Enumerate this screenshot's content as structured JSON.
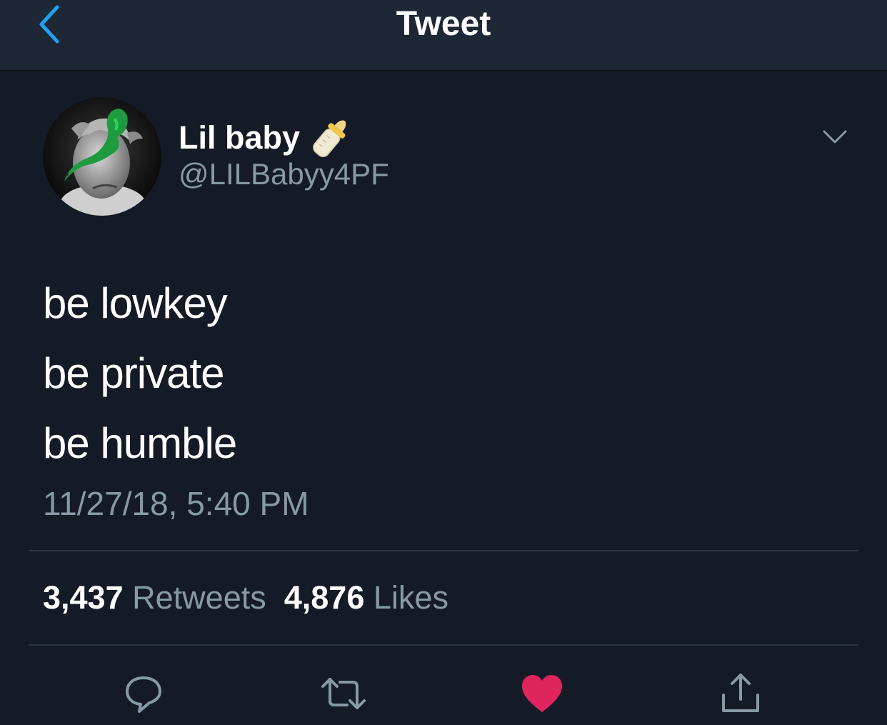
{
  "navbar": {
    "title": "Tweet",
    "back_icon": "chevron-left-icon"
  },
  "author": {
    "display_name": "Lil baby",
    "name_emoji": "baby-bottle-icon",
    "handle": "@LILBabyy4PF",
    "menu_icon": "chevron-down-icon"
  },
  "tweet": {
    "lines": [
      "be lowkey",
      "be private",
      "be humble"
    ],
    "timestamp": "11/27/18, 5:40 PM"
  },
  "stats": {
    "retweets_count": "3,437",
    "retweets_label": "Retweets",
    "likes_count": "4,876",
    "likes_label": "Likes"
  },
  "actions": {
    "reply_icon": "reply-icon",
    "retweet_icon": "retweet-icon",
    "like_icon": "heart-icon",
    "share_icon": "share-icon",
    "liked": true
  },
  "colors": {
    "background": "#151b26",
    "navbar": "#1d2735",
    "accent": "#1da1f2",
    "secondary_text": "#8899a6",
    "like": "#e0245e"
  }
}
